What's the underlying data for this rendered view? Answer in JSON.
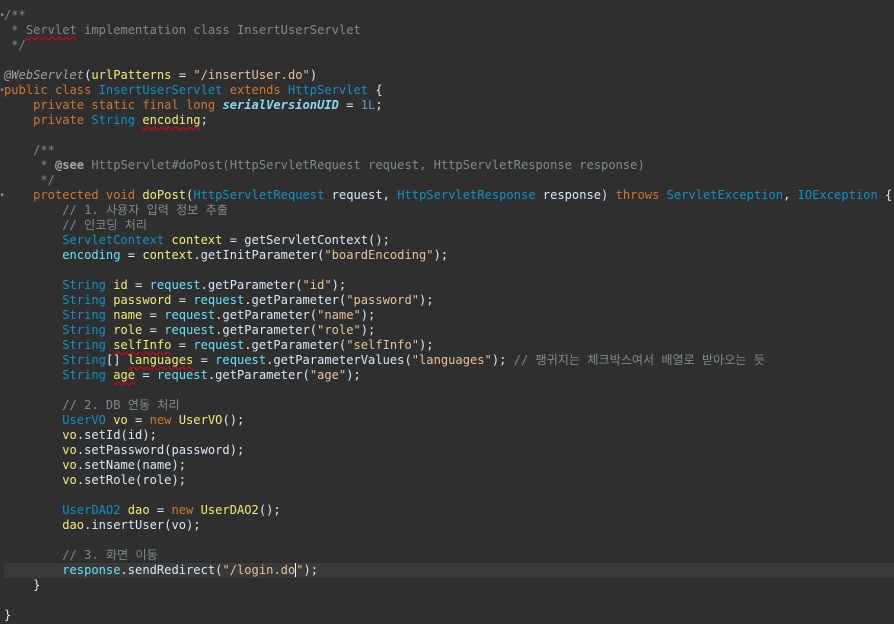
{
  "editor": {
    "lines": [
      [
        {
          "t": "/**",
          "c": "comment"
        }
      ],
      [
        {
          "t": " * ",
          "c": "comment"
        },
        {
          "t": "Servlet",
          "c": "comment squiggle"
        },
        {
          "t": " implementation class InsertUserServlet",
          "c": "comment"
        }
      ],
      [
        {
          "t": " */",
          "c": "comment"
        }
      ],
      [],
      [
        {
          "t": "@WebServlet",
          "c": "annotation"
        },
        {
          "t": "(",
          "c": "plain"
        },
        {
          "t": "urlPatterns",
          "c": "local"
        },
        {
          "t": " = ",
          "c": "plain"
        },
        {
          "t": "\"/insertUser.do\"",
          "c": "str"
        },
        {
          "t": ")",
          "c": "plain"
        }
      ],
      [
        {
          "t": "public class ",
          "c": "kw"
        },
        {
          "t": "InsertUserServlet",
          "c": "cls"
        },
        {
          "t": " extends ",
          "c": "kw"
        },
        {
          "t": "HttpServlet",
          "c": "cls"
        },
        {
          "t": " {",
          "c": "plain"
        }
      ],
      [
        {
          "t": "    private static final long ",
          "c": "kw"
        },
        {
          "t": "serialVersionUID",
          "c": "const"
        },
        {
          "t": " = ",
          "c": "plain"
        },
        {
          "t": "1L",
          "c": "num"
        },
        {
          "t": ";",
          "c": "plain"
        }
      ],
      [
        {
          "t": "    private ",
          "c": "kw"
        },
        {
          "t": "String ",
          "c": "cls"
        },
        {
          "t": "encoding",
          "c": "local squiggle"
        },
        {
          "t": ";",
          "c": "plain"
        }
      ],
      [],
      [
        {
          "t": "    /**",
          "c": "comment"
        }
      ],
      [
        {
          "t": "     * ",
          "c": "comment"
        },
        {
          "t": "@see",
          "c": "doc-tag"
        },
        {
          "t": " HttpServlet#doPost(HttpServletRequest request, HttpServletResponse response)",
          "c": "comment"
        }
      ],
      [
        {
          "t": "     */",
          "c": "comment"
        }
      ],
      [
        {
          "t": "    protected void ",
          "c": "kw"
        },
        {
          "t": "doPost",
          "c": "local"
        },
        {
          "t": "(",
          "c": "plain"
        },
        {
          "t": "HttpServletRequest",
          "c": "cls"
        },
        {
          "t": " request, ",
          "c": "plain"
        },
        {
          "t": "HttpServletResponse",
          "c": "cls"
        },
        {
          "t": " response) ",
          "c": "plain"
        },
        {
          "t": "throws ",
          "c": "kw"
        },
        {
          "t": "ServletException",
          "c": "cls"
        },
        {
          "t": ", ",
          "c": "plain"
        },
        {
          "t": "IOException",
          "c": "cls"
        },
        {
          "t": " {",
          "c": "plain"
        }
      ],
      [
        {
          "t": "        // 1. 사용자 입력 정보 추출",
          "c": "comment"
        }
      ],
      [
        {
          "t": "        // 인코딩 처리",
          "c": "comment"
        }
      ],
      [
        {
          "t": "        ServletContext",
          "c": "cls"
        },
        {
          "t": " context",
          "c": "local"
        },
        {
          "t": " = getServletContext();",
          "c": "plain"
        }
      ],
      [
        {
          "t": "        encoding",
          "c": "field"
        },
        {
          "t": " = ",
          "c": "plain"
        },
        {
          "t": "context",
          "c": "local"
        },
        {
          "t": ".getInitParameter(",
          "c": "plain"
        },
        {
          "t": "\"boardEncoding\"",
          "c": "str"
        },
        {
          "t": ");",
          "c": "plain"
        }
      ],
      [],
      [
        {
          "t": "        String",
          "c": "cls"
        },
        {
          "t": " id",
          "c": "local"
        },
        {
          "t": " = ",
          "c": "plain"
        },
        {
          "t": "request",
          "c": "field"
        },
        {
          "t": ".getParameter(",
          "c": "plain"
        },
        {
          "t": "\"id\"",
          "c": "str"
        },
        {
          "t": ");",
          "c": "plain"
        }
      ],
      [
        {
          "t": "        String",
          "c": "cls"
        },
        {
          "t": " password",
          "c": "local"
        },
        {
          "t": " = ",
          "c": "plain"
        },
        {
          "t": "request",
          "c": "field"
        },
        {
          "t": ".getParameter(",
          "c": "plain"
        },
        {
          "t": "\"password\"",
          "c": "str"
        },
        {
          "t": ");",
          "c": "plain"
        }
      ],
      [
        {
          "t": "        String",
          "c": "cls"
        },
        {
          "t": " name",
          "c": "local"
        },
        {
          "t": " = ",
          "c": "plain"
        },
        {
          "t": "request",
          "c": "field"
        },
        {
          "t": ".getParameter(",
          "c": "plain"
        },
        {
          "t": "\"name\"",
          "c": "str"
        },
        {
          "t": ");",
          "c": "plain"
        }
      ],
      [
        {
          "t": "        String",
          "c": "cls"
        },
        {
          "t": " role",
          "c": "local"
        },
        {
          "t": " = ",
          "c": "plain"
        },
        {
          "t": "request",
          "c": "field"
        },
        {
          "t": ".getParameter(",
          "c": "plain"
        },
        {
          "t": "\"role\"",
          "c": "str"
        },
        {
          "t": ");",
          "c": "plain"
        }
      ],
      [
        {
          "t": "        String ",
          "c": "cls"
        },
        {
          "t": "selfInfo",
          "c": "local squiggle"
        },
        {
          "t": " = ",
          "c": "plain"
        },
        {
          "t": "request",
          "c": "field"
        },
        {
          "t": ".getParameter(",
          "c": "plain"
        },
        {
          "t": "\"selfInfo\"",
          "c": "str"
        },
        {
          "t": ");",
          "c": "plain"
        }
      ],
      [
        {
          "t": "        String",
          "c": "cls"
        },
        {
          "t": "[] ",
          "c": "plain"
        },
        {
          "t": "languages",
          "c": "local squiggle"
        },
        {
          "t": " = ",
          "c": "plain"
        },
        {
          "t": "request",
          "c": "field"
        },
        {
          "t": ".getParameterValues(",
          "c": "plain"
        },
        {
          "t": "\"languages\"",
          "c": "str"
        },
        {
          "t": "); ",
          "c": "plain"
        },
        {
          "t": "// 팽귀지는 체크박스여서 배열로 받아오는 듯",
          "c": "comment"
        }
      ],
      [
        {
          "t": "        String ",
          "c": "cls"
        },
        {
          "t": "age",
          "c": "local squiggle"
        },
        {
          "t": " = ",
          "c": "plain"
        },
        {
          "t": "request",
          "c": "field"
        },
        {
          "t": ".getParameter(",
          "c": "plain"
        },
        {
          "t": "\"age\"",
          "c": "str"
        },
        {
          "t": ");",
          "c": "plain"
        }
      ],
      [],
      [
        {
          "t": "        // 2. DB 연동 처리",
          "c": "comment"
        }
      ],
      [
        {
          "t": "        UserVO",
          "c": "cls"
        },
        {
          "t": " vo",
          "c": "local"
        },
        {
          "t": " = ",
          "c": "plain"
        },
        {
          "t": "new ",
          "c": "kw"
        },
        {
          "t": "UserVO",
          "c": "local"
        },
        {
          "t": "();",
          "c": "plain"
        }
      ],
      [
        {
          "t": "        vo",
          "c": "local"
        },
        {
          "t": ".setId(id);",
          "c": "plain"
        }
      ],
      [
        {
          "t": "        vo",
          "c": "local"
        },
        {
          "t": ".setPassword(password);",
          "c": "plain"
        }
      ],
      [
        {
          "t": "        vo",
          "c": "local"
        },
        {
          "t": ".setName(name);",
          "c": "plain"
        }
      ],
      [
        {
          "t": "        vo",
          "c": "local"
        },
        {
          "t": ".setRole(role);",
          "c": "plain"
        }
      ],
      [],
      [
        {
          "t": "        UserDAO2",
          "c": "cls"
        },
        {
          "t": " dao",
          "c": "local"
        },
        {
          "t": " = ",
          "c": "plain"
        },
        {
          "t": "new ",
          "c": "kw"
        },
        {
          "t": "UserDAO2",
          "c": "local"
        },
        {
          "t": "();",
          "c": "plain"
        }
      ],
      [
        {
          "t": "        dao",
          "c": "local"
        },
        {
          "t": ".insertUser(vo);",
          "c": "plain"
        }
      ],
      [],
      [
        {
          "t": "        // 3. 화면 이동",
          "c": "comment"
        }
      ],
      [
        {
          "t": "        response",
          "c": "field"
        },
        {
          "t": ".sendRedirect(",
          "c": "plain"
        },
        {
          "t": "\"/login.do",
          "c": "str"
        },
        {
          "t": "CARET",
          "c": "caret"
        },
        {
          "t": "\"",
          "c": "str"
        },
        {
          "t": ");",
          "c": "plain"
        }
      ],
      [
        {
          "t": "    }",
          "c": "plain"
        }
      ],
      [],
      [
        {
          "t": "}",
          "c": "plain"
        }
      ]
    ],
    "current_line": 37,
    "fold_markers": [
      0,
      5,
      12
    ]
  }
}
